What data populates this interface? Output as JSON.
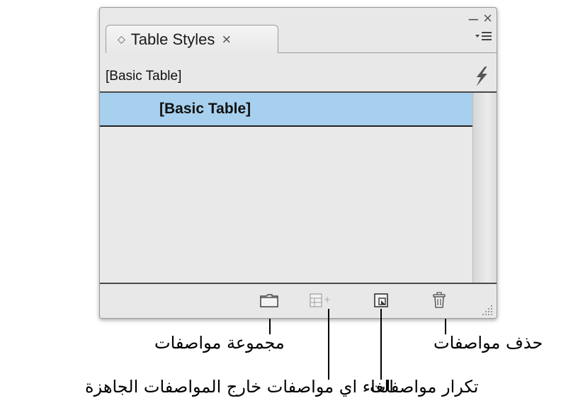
{
  "panel": {
    "tab_title": "Table Styles",
    "tab_close": "×",
    "tab_collapse_icon": "◇",
    "window_min": "–",
    "window_close": "×",
    "current_style": "[Basic Table]",
    "styles": [
      {
        "label": "[Basic Table]",
        "selected": true
      }
    ],
    "selected_color": "#a7d0ee"
  },
  "footer_buttons": [
    {
      "name": "new-style-group-button",
      "icon": "folder-icon",
      "enabled": true
    },
    {
      "name": "clear-overrides-button",
      "icon": "clear-overrides-icon",
      "enabled": false
    },
    {
      "name": "new-style-button",
      "icon": "new-style-icon",
      "enabled": true
    },
    {
      "name": "delete-style-button",
      "icon": "trash-icon",
      "enabled": true
    }
  ],
  "callouts": {
    "group": "مجموعة مواصفات",
    "clear": "الغاء اي مواصفات خارج المواصفات الجاهزة",
    "new": "تكرار مواصفات",
    "delete": "حذف مواصفات"
  }
}
